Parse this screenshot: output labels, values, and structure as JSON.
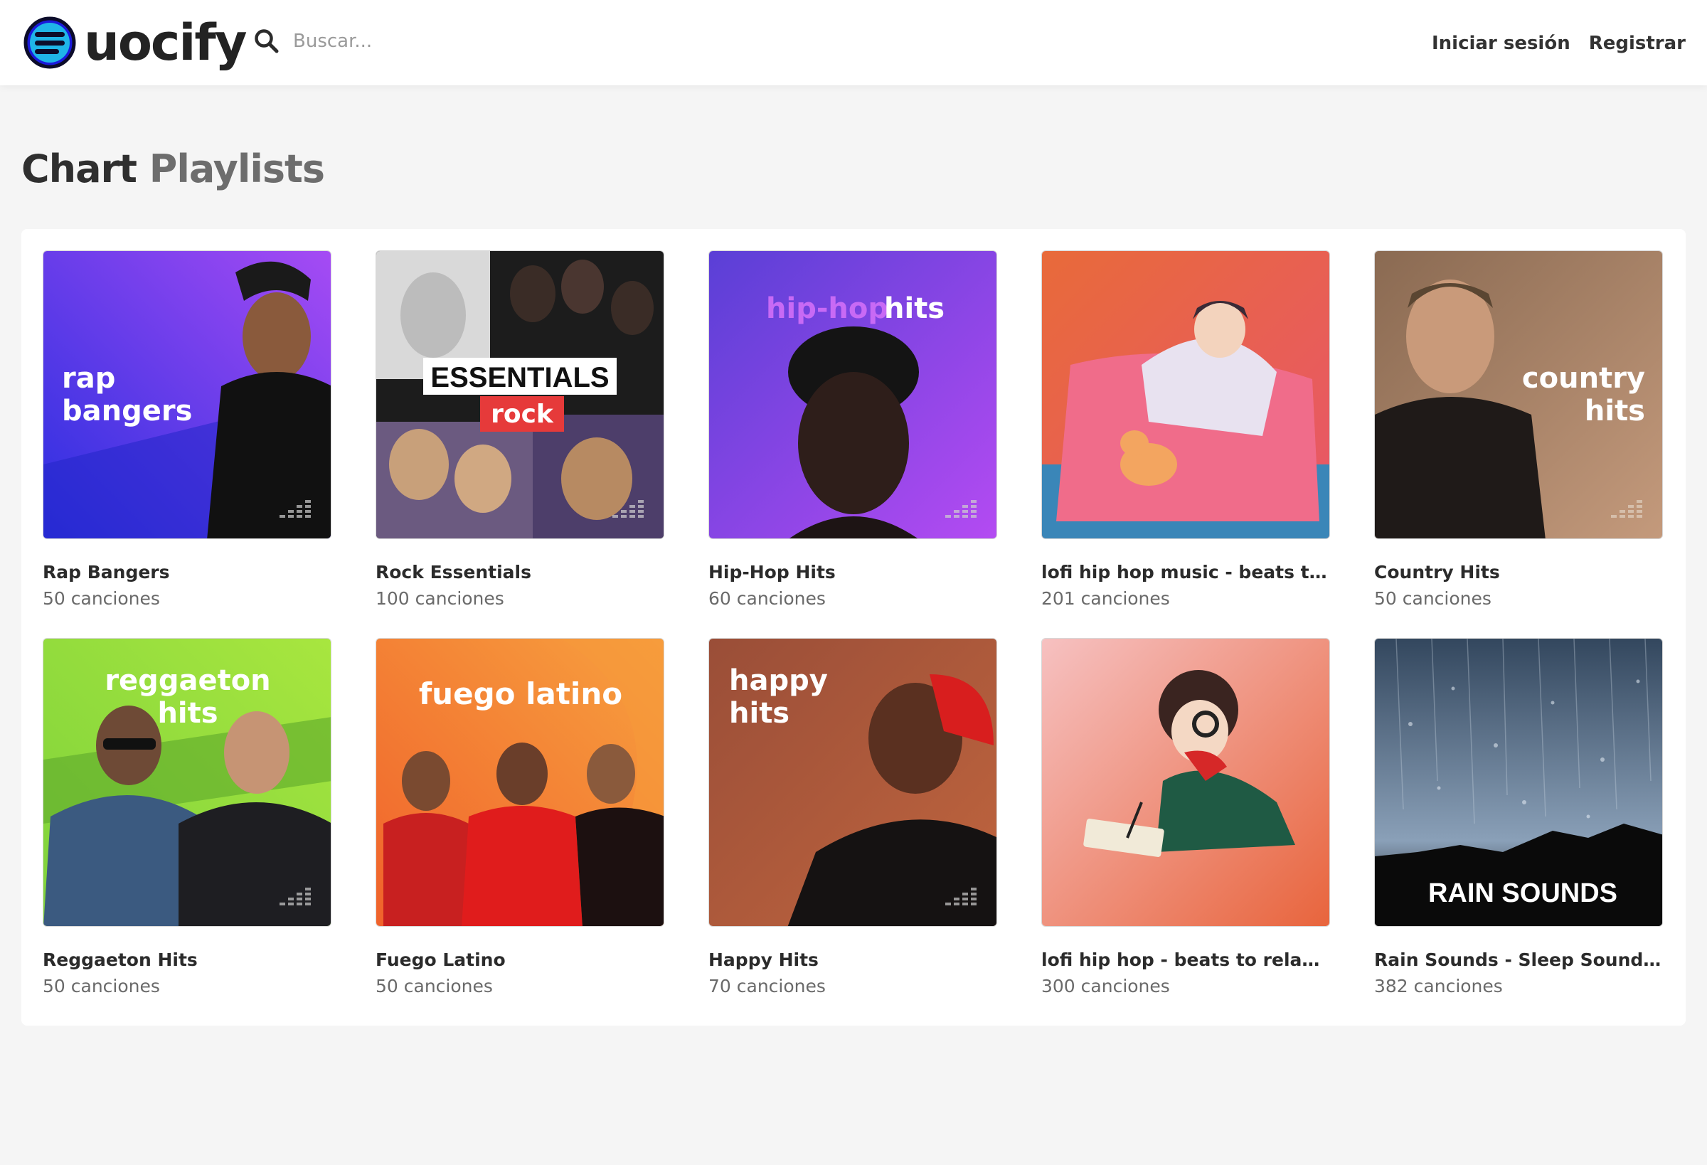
{
  "app": {
    "logo_text": "uocify",
    "brand_color": "#1a1adb"
  },
  "search": {
    "placeholder": "Buscar..."
  },
  "nav": {
    "login_label": "Iniciar sesión",
    "register_label": "Registrar"
  },
  "section": {
    "title_part1": "Chart",
    "title_part2": "Playlists"
  },
  "playlists": [
    {
      "title": "Rap Bangers",
      "count": "50 canciones",
      "cover_text": [
        "rap",
        "bangers"
      ],
      "colors": [
        "#2a2fe0",
        "#a64bf4"
      ]
    },
    {
      "title": "Rock Essentials",
      "count": "100 canciones",
      "cover_text": [
        "ESSENTIALS",
        "rock"
      ],
      "colors": [
        "#1c1c1c",
        "#e63a3a"
      ]
    },
    {
      "title": "Hip-Hop Hits",
      "count": "60 canciones",
      "cover_text": [
        "hip-hop",
        "hits"
      ],
      "colors": [
        "#5a3fd6",
        "#b44bf2"
      ]
    },
    {
      "title": "lofi hip hop music - beats to sl...",
      "count": "201 canciones",
      "cover_text": [],
      "colors": [
        "#e86a3a",
        "#e8566a"
      ]
    },
    {
      "title": "Country Hits",
      "count": "50 canciones",
      "cover_text": [
        "country",
        "hits"
      ],
      "colors": [
        "#8a6a52",
        "#c49a7c"
      ]
    },
    {
      "title": "Reggaeton Hits",
      "count": "50 canciones",
      "cover_text": [
        "reggaeton",
        "hits"
      ],
      "colors": [
        "#7ed23b",
        "#a8e63f"
      ]
    },
    {
      "title": "Fuego Latino",
      "count": "50 canciones",
      "cover_text": [
        "fuego latino"
      ],
      "colors": [
        "#f0622b",
        "#f7a13f"
      ]
    },
    {
      "title": "Happy Hits",
      "count": "70 canciones",
      "cover_text": [
        "happy",
        "hits"
      ],
      "colors": [
        "#9a4e38",
        "#c0653e"
      ]
    },
    {
      "title": "lofi hip hop - beats to relax/st...",
      "count": "300 canciones",
      "cover_text": [],
      "colors": [
        "#f6c1c1",
        "#e8643c"
      ]
    },
    {
      "title": "Rain Sounds - Sleep Sounds - ...",
      "count": "382 canciones",
      "cover_text": [
        "RAIN SOUNDS"
      ],
      "colors": [
        "#33475e",
        "#0c0c0c"
      ]
    }
  ]
}
